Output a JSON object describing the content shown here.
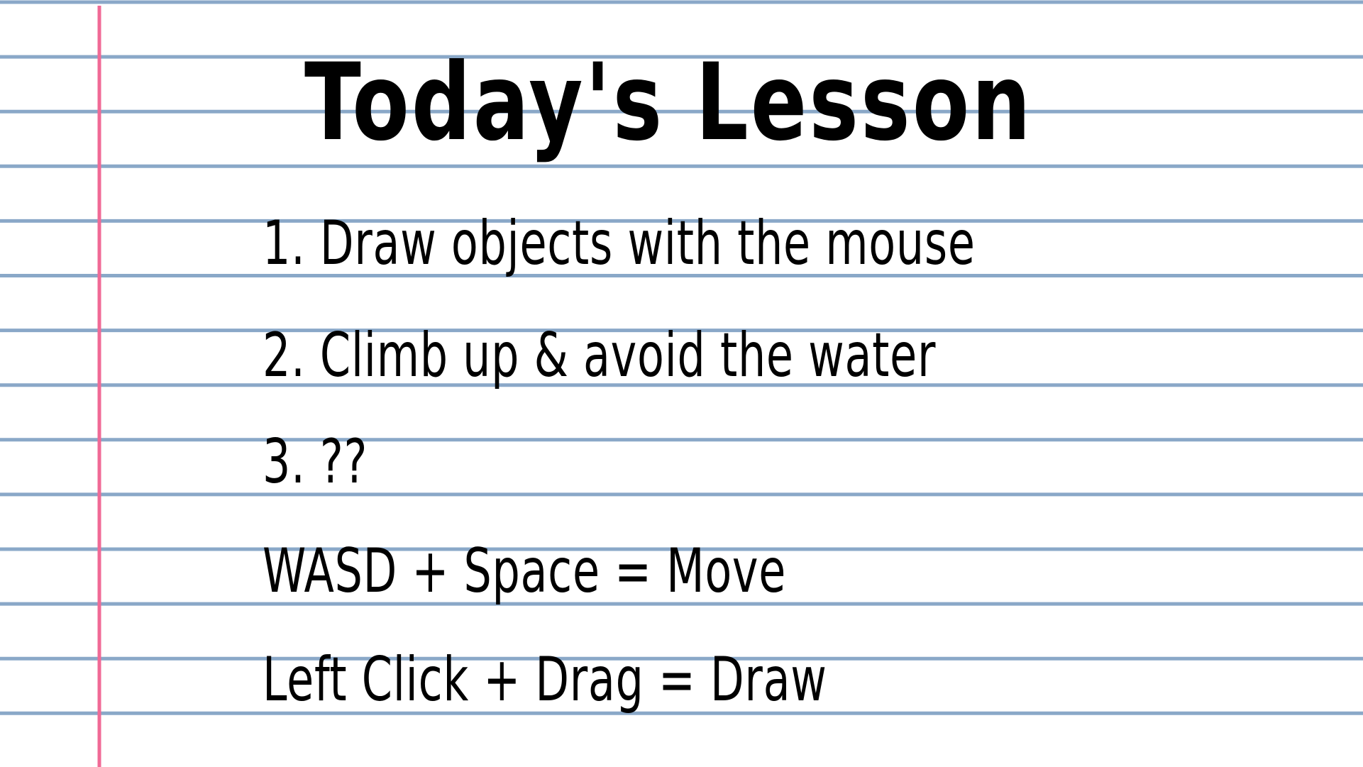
{
  "colors": {
    "paper": "#ffffff",
    "ruled_line": "#8aa8c8",
    "margin_line": "#f06a96",
    "ink": "#000000"
  },
  "lesson": {
    "title": "Today's Lesson",
    "items": [
      "1. Draw objects with the mouse",
      "2. Climb up & avoid the water",
      "3. ??"
    ],
    "controls": [
      "WASD + Space = Move",
      "Left Click + Drag = Draw"
    ]
  }
}
